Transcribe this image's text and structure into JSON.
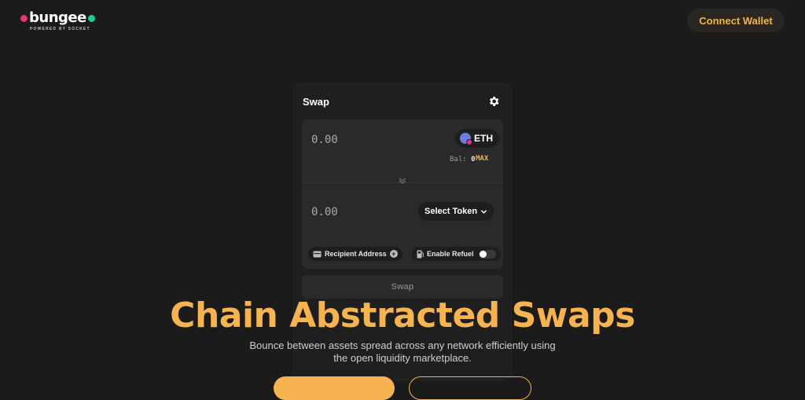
{
  "header": {
    "logo_text": "bungee",
    "logo_subtext": "POWERED BY SOCKET",
    "connect_wallet_label": "Connect Wallet"
  },
  "swap": {
    "title": "Swap",
    "from_amount": "0.00",
    "from_token": "ETH",
    "balance_label": "Bal:",
    "balance_value": "0",
    "max_label": "MAX",
    "to_amount": "0.00",
    "select_token_label": "Select Token",
    "recipient_label": "Recipient Address",
    "refuel_label": "Enable Refuel",
    "swap_button_label": "Swap"
  },
  "hero": {
    "title": "Chain Abstracted Swaps",
    "subtitle": "Bounce between assets spread across any network efficiently using the open liquidity marketplace."
  },
  "colors": {
    "accent": "#f6b34f",
    "background": "#1b1b1b",
    "card": "#1f1f20",
    "panel": "#2a2a2b"
  },
  "icons": [
    "gear-icon",
    "eth-token-icon",
    "chevron-down-icon",
    "swap-direction-icon",
    "wallet-icon",
    "plus-icon",
    "fuel-icon"
  ]
}
